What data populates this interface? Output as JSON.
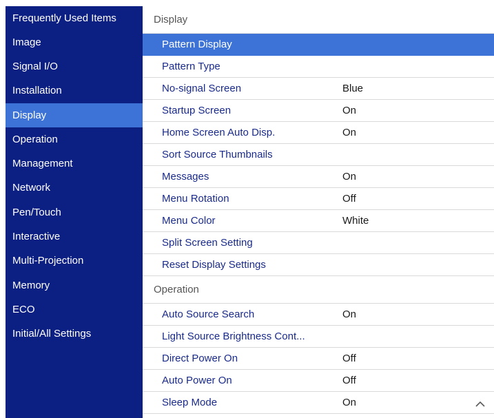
{
  "colors": {
    "sidebar_bg": "#0c1f82",
    "selected_bg": "#3d73d6",
    "row_text": "#1a2a8a"
  },
  "sidebar": {
    "selected_index": 4,
    "items": [
      {
        "label": "Frequently Used Items"
      },
      {
        "label": "Image"
      },
      {
        "label": "Signal I/O"
      },
      {
        "label": "Installation"
      },
      {
        "label": "Display"
      },
      {
        "label": "Operation"
      },
      {
        "label": "Management"
      },
      {
        "label": "Network"
      },
      {
        "label": "Pen/Touch"
      },
      {
        "label": "Interactive"
      },
      {
        "label": "Multi-Projection"
      },
      {
        "label": "Memory"
      },
      {
        "label": "ECO"
      },
      {
        "label": "Initial/All Settings"
      }
    ]
  },
  "main": {
    "display_section": {
      "heading": "Display",
      "rows": [
        {
          "label": "Pattern Display",
          "value": ""
        },
        {
          "label": "Pattern Type",
          "value": ""
        },
        {
          "label": "No-signal Screen",
          "value": "Blue"
        },
        {
          "label": "Startup Screen",
          "value": "On"
        },
        {
          "label": "Home Screen Auto Disp.",
          "value": "On"
        },
        {
          "label": "Sort Source Thumbnails",
          "value": ""
        },
        {
          "label": "Messages",
          "value": "On"
        },
        {
          "label": "Menu Rotation",
          "value": "Off"
        },
        {
          "label": "Menu Color",
          "value": "White"
        },
        {
          "label": "Split Screen Setting",
          "value": ""
        },
        {
          "label": "Reset Display Settings",
          "value": ""
        }
      ]
    },
    "operation_section": {
      "heading": "Operation",
      "rows": [
        {
          "label": "Auto Source Search",
          "value": "On"
        },
        {
          "label": "Light Source Brightness Cont...",
          "value": ""
        },
        {
          "label": "Direct Power On",
          "value": "Off"
        },
        {
          "label": "Auto Power On",
          "value": "Off"
        },
        {
          "label": "Sleep Mode",
          "value": "On"
        }
      ]
    },
    "scroll_icon": "chevron-up-icon"
  }
}
